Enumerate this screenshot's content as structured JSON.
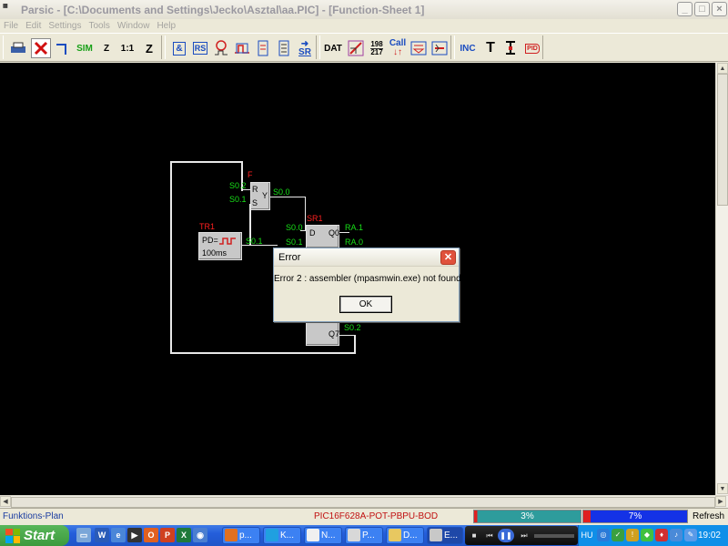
{
  "window": {
    "title": "Parsic - [C:\\Documents and Settings\\Jecko\\Asztal\\aa.PIC] - [Function-Sheet 1]",
    "icon_text": "Parsic",
    "controls": [
      "_",
      "□",
      "×"
    ]
  },
  "menu": [
    "File",
    "Edit",
    "Settings",
    "Tools",
    "Window",
    "Help"
  ],
  "toolbar": {
    "groups": [
      [
        "print-icon",
        "delete-x-icon",
        "wire-icon",
        "SIM",
        "Z",
        "1:1",
        "Z"
      ],
      [
        "&",
        "RS",
        "timer-icon",
        "counter-icon",
        "shift-icon",
        "register-icon",
        "SR"
      ],
      [
        "DAT",
        "analog-icon",
        "198/217",
        "Call",
        "compare-icon",
        "memory-icon"
      ],
      [
        "INC",
        "T",
        "text-icon",
        "PID"
      ]
    ],
    "labels": {
      "sim": "SIM",
      "z1": "Z",
      "one_to_one": "1:1",
      "z2": "Z",
      "and": "&",
      "rs": "RS",
      "sr": "SR",
      "dat": "DAT",
      "num_top": "198",
      "num_bottom": "217",
      "call": "Call",
      "inc": "INC",
      "t": "T",
      "pid": "PID"
    }
  },
  "diagram": {
    "ff_name": "F",
    "ff_in1": "S0.2",
    "ff_in2": "S0.1",
    "ff_r": "R",
    "ff_s": "S",
    "ff_out_pin": "Y",
    "ff_out": "S0.0",
    "timer_name": "TR1",
    "timer_pd": "PD=",
    "timer_time": "100ms",
    "timer_out": "S0.1",
    "sr_name": "SR1",
    "sr_in_d": "S0.0",
    "sr_in_clk": "S0.1",
    "sr_d": "D",
    "sr_q0": "Q0",
    "sr_out_q0": "RA.1",
    "sr_out_q1": "RA.0",
    "sr_q7": "Q7",
    "sr_out_q7": "S0.2"
  },
  "dialog": {
    "title": "Error",
    "message": "Error 2 : assembler (mpasmwin.exe) not found !",
    "ok_label": "OK"
  },
  "statusbar": {
    "mode": "Funktions-Plan",
    "chip": "PIC16F628A-POT-PBPU-BOD",
    "progress1": {
      "text": "3%",
      "value": 0.03
    },
    "progress2": {
      "text": "7%",
      "value": 0.07
    },
    "refresh": "Refresh"
  },
  "taskbar": {
    "start_label": "Start",
    "tasks": [
      "p...",
      "K...",
      "N...",
      "P...",
      "D...",
      "E..."
    ],
    "lang": "HU",
    "clock": "19:02"
  },
  "colors": {
    "signal_green": "#18e018",
    "label_red": "#ff2020",
    "progress1": "#2e9c9c",
    "progress2": "#1432e6",
    "progress_marker": "#e02020"
  }
}
